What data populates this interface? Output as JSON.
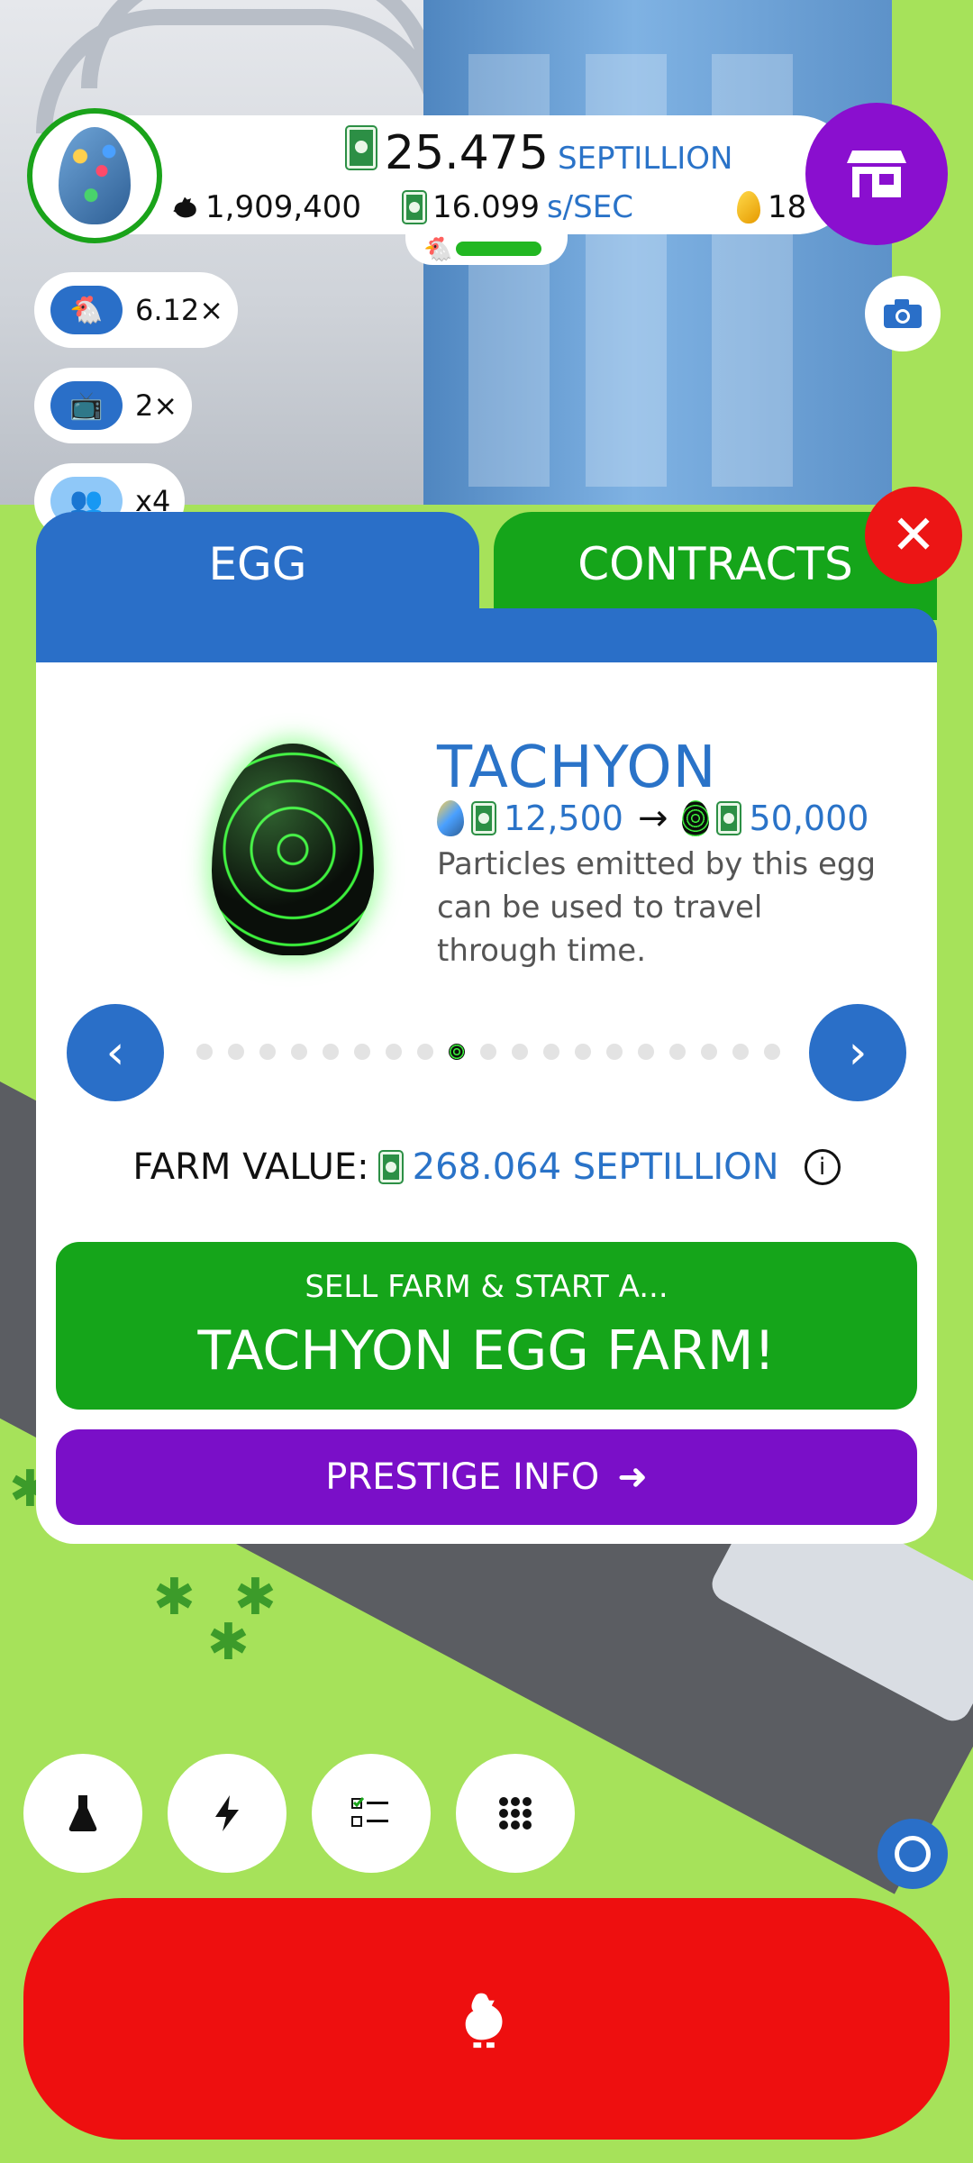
{
  "colors": {
    "blue": "#2a6fc8",
    "green": "#15a51a",
    "purple": "#7a0fc8",
    "red": "#ee0f0f",
    "grass": "#a6e25a"
  },
  "hud": {
    "cash_amount": "25.475",
    "cash_unit": "SEPTILLION",
    "chicken_count": "1,909,400",
    "earnings_rate": "16.099",
    "earnings_unit": "s/SEC",
    "golden_eggs": "18",
    "hab_fill": 0.85
  },
  "boosts": [
    {
      "icon": "chicken-icon",
      "label": "6.12×"
    },
    {
      "icon": "tv-icon",
      "label": "2×"
    },
    {
      "icon": "friends-icon",
      "label": "x4"
    }
  ],
  "tabs": {
    "egg": "EGG",
    "contracts": "CONTRACTS"
  },
  "egg": {
    "name": "TACHYON",
    "price_from": "12,500",
    "price_to": "50,000",
    "description": "Particles emitted by this egg can be used to travel through time."
  },
  "carousel": {
    "total_dots": 19,
    "selected_index": 8
  },
  "farm": {
    "value_label": "FARM VALUE:",
    "value_amount": "268.064 SEPTILLION"
  },
  "actions": {
    "sell_pre": "SELL FARM & START A...",
    "sell_main": "TACHYON EGG FARM!",
    "prestige": "PRESTIGE INFO"
  },
  "bottom_icons": [
    "research-flask-icon",
    "boost-bolt-icon",
    "missions-checklist-icon",
    "menu-grid-icon"
  ]
}
